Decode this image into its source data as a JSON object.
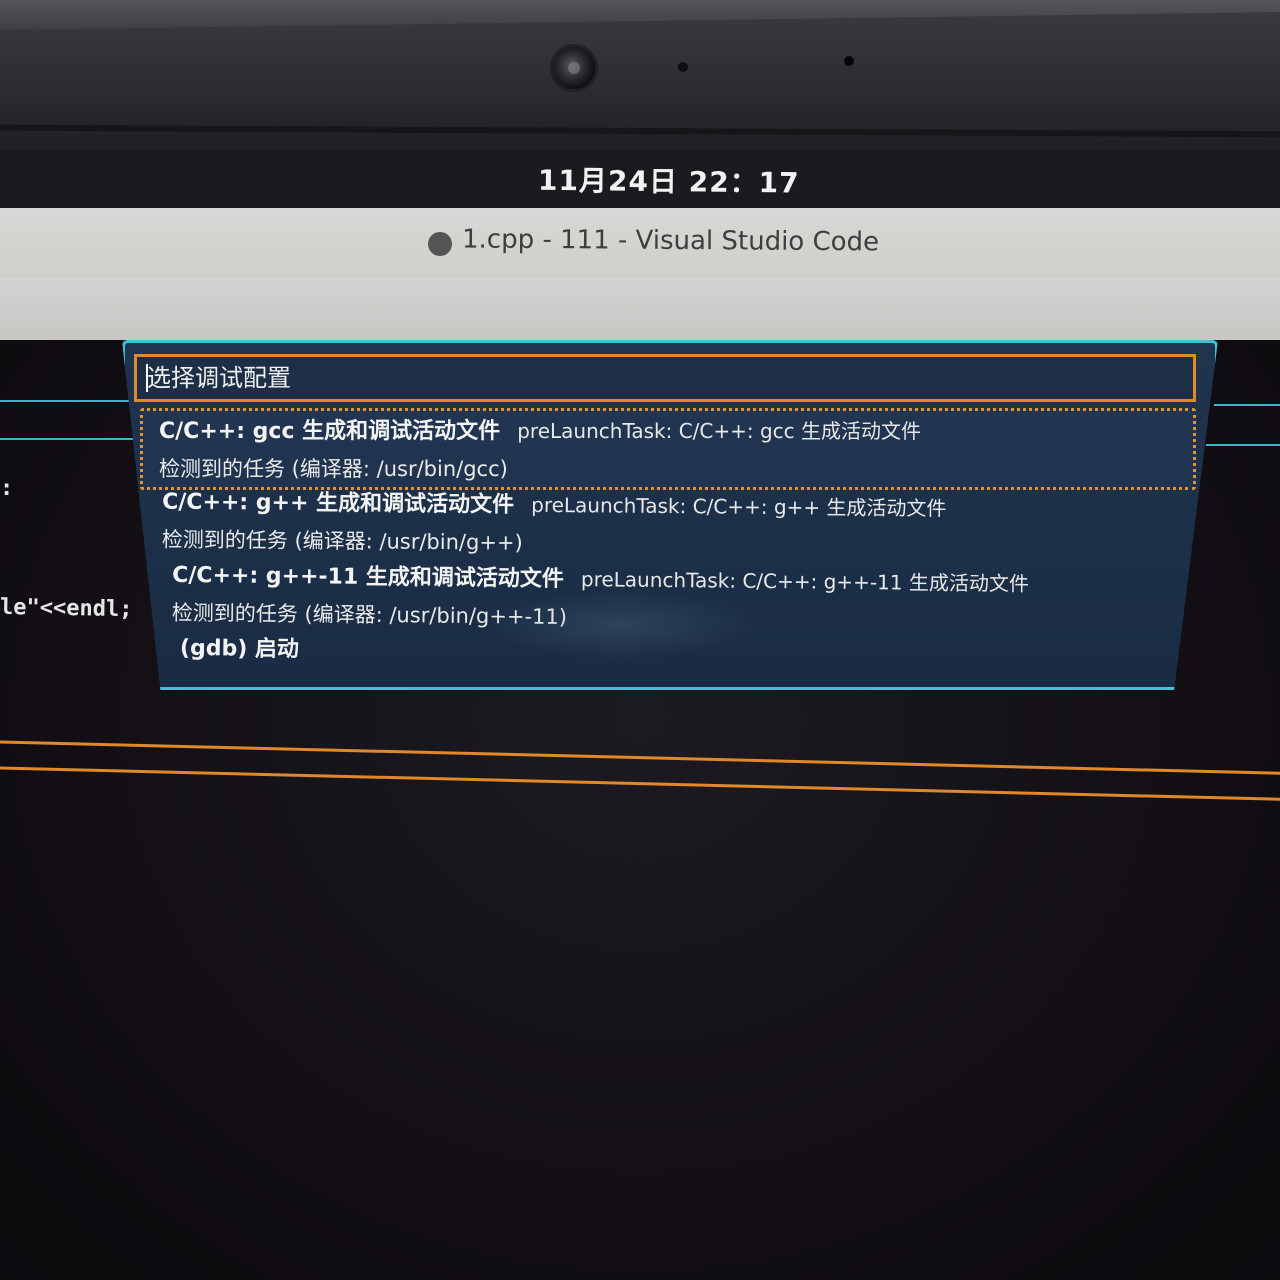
{
  "system": {
    "clock": "11月24日  22：17"
  },
  "window": {
    "title": "1.cpp - 111 - Visual Studio Code"
  },
  "editor": {
    "code_fragments": [
      ":",
      "le\"<<endl;"
    ]
  },
  "quick_pick": {
    "placeholder": "选择调试配置",
    "items": [
      {
        "label": "C/C++: gcc 生成和调试活动文件",
        "description": "preLaunchTask: C/C++: gcc 生成活动文件",
        "detail": "检测到的任务 (编译器: /usr/bin/gcc)"
      },
      {
        "label": "C/C++: g++ 生成和调试活动文件",
        "description": "preLaunchTask: C/C++: g++ 生成活动文件",
        "detail": "检测到的任务 (编译器: /usr/bin/g++)"
      },
      {
        "label": "C/C++: g++-11 生成和调试活动文件",
        "description": "preLaunchTask: C/C++: g++-11 生成活动文件",
        "detail": "检测到的任务 (编译器: /usr/bin/g++-11)"
      },
      {
        "label": "(gdb) 启动"
      }
    ]
  },
  "colors": {
    "quick_pick_border": "#3ec2d6",
    "focus_border": "#e08a2c",
    "quick_pick_bg": "#1c3049"
  }
}
